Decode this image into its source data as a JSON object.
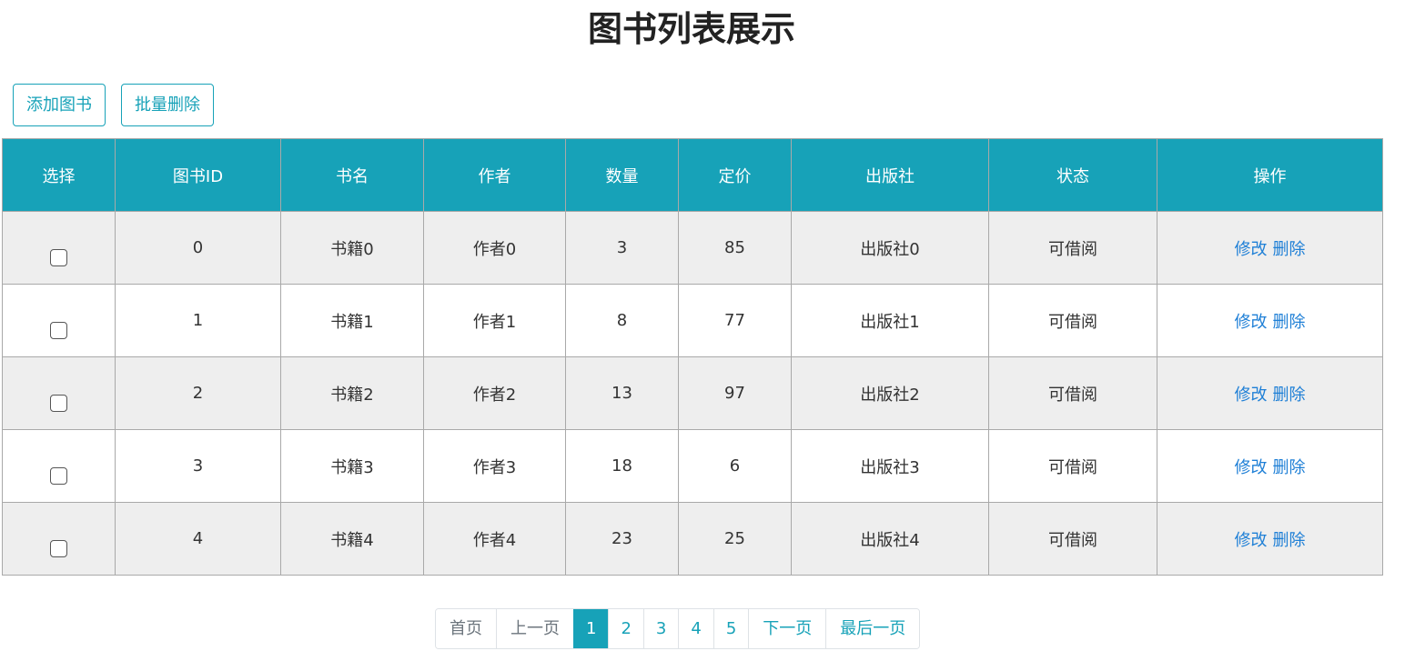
{
  "page": {
    "title": "图书列表展示"
  },
  "toolbar": {
    "add_label": "添加图书",
    "batch_delete_label": "批量删除"
  },
  "table": {
    "headers": [
      "选择",
      "图书ID",
      "书名",
      "作者",
      "数量",
      "定价",
      "出版社",
      "状态",
      "操作"
    ],
    "rows": [
      {
        "id": "0",
        "name": "书籍0",
        "author": "作者0",
        "count": "3",
        "price": "85",
        "publisher": "出版社0",
        "status": "可借阅"
      },
      {
        "id": "1",
        "name": "书籍1",
        "author": "作者1",
        "count": "8",
        "price": "77",
        "publisher": "出版社1",
        "status": "可借阅"
      },
      {
        "id": "2",
        "name": "书籍2",
        "author": "作者2",
        "count": "13",
        "price": "97",
        "publisher": "出版社2",
        "status": "可借阅"
      },
      {
        "id": "3",
        "name": "书籍3",
        "author": "作者3",
        "count": "18",
        "price": "6",
        "publisher": "出版社3",
        "status": "可借阅"
      },
      {
        "id": "4",
        "name": "书籍4",
        "author": "作者4",
        "count": "23",
        "price": "25",
        "publisher": "出版社4",
        "status": "可借阅"
      }
    ],
    "edit_label": "修改",
    "delete_label": "删除"
  },
  "pagination": {
    "first": "首页",
    "prev": "上一页",
    "pages": [
      "1",
      "2",
      "3",
      "4",
      "5"
    ],
    "next": "下一页",
    "last": "最后一页"
  },
  "colors": {
    "accent": "#17a2b8",
    "link": "#1e7fd6",
    "row_alt": "#eeeeee"
  }
}
